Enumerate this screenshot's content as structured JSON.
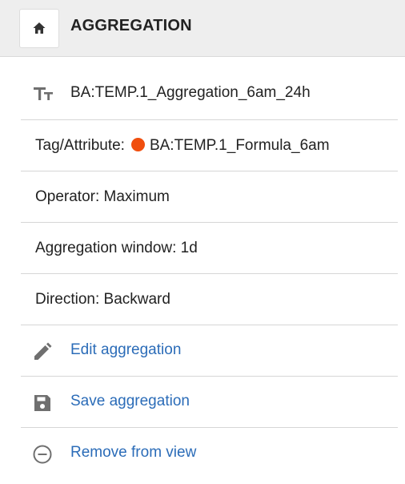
{
  "header": {
    "title": "AGGREGATION",
    "home_icon": "home-icon"
  },
  "details": {
    "name": "BA:TEMP.1_Aggregation_6am_24h",
    "name_icon": "text-type-icon",
    "tag_label": "Tag/Attribute:",
    "tag_value": "BA:TEMP.1_Formula_6am",
    "tag_status_color": "#f04e0e",
    "operator": "Operator: Maximum",
    "window": "Aggregation window: 1d",
    "direction": "Direction: Backward"
  },
  "actions": {
    "edit": "Edit aggregation",
    "save": "Save aggregation",
    "remove": "Remove from view"
  },
  "colors": {
    "link": "#2b6cb8",
    "header_bg": "#eeeeee",
    "icon_gray": "#6f6f6f"
  }
}
